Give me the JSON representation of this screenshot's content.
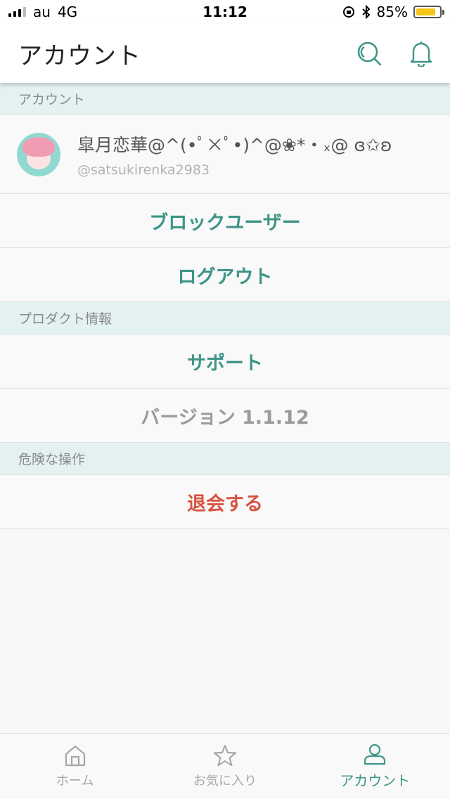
{
  "status_bar": {
    "carrier": "au",
    "network": "4G",
    "time": "11:12",
    "battery_percent": "85%",
    "battery_level": 0.85,
    "icons": [
      "signal-icon",
      "rotation-lock-icon",
      "bluetooth-icon",
      "battery-icon"
    ]
  },
  "header": {
    "title": "アカウント",
    "search_icon": "search-icon",
    "bell_icon": "bell-icon"
  },
  "sections": {
    "account": {
      "title": "アカウント",
      "profile_name": "皐月恋華@^(•ﾟ×ﾟ•)^@❀*・ₓ@ ɞ✩ʚ",
      "profile_handle": "@satsukirenka2983",
      "block_users": "ブロックユーザー",
      "logout": "ログアウト"
    },
    "product": {
      "title": "プロダクト情報",
      "support": "サポート",
      "version": "バージョン 1.1.12"
    },
    "danger": {
      "title": "危険な操作",
      "withdraw": "退会する"
    }
  },
  "tab_bar": {
    "home": "ホーム",
    "favorites": "お気に入り",
    "account": "アカウント",
    "active": "account"
  },
  "colors": {
    "accent": "#3e9588",
    "danger": "#d9533f",
    "section_bg": "#e3f1f1",
    "battery": "#f5c518"
  }
}
